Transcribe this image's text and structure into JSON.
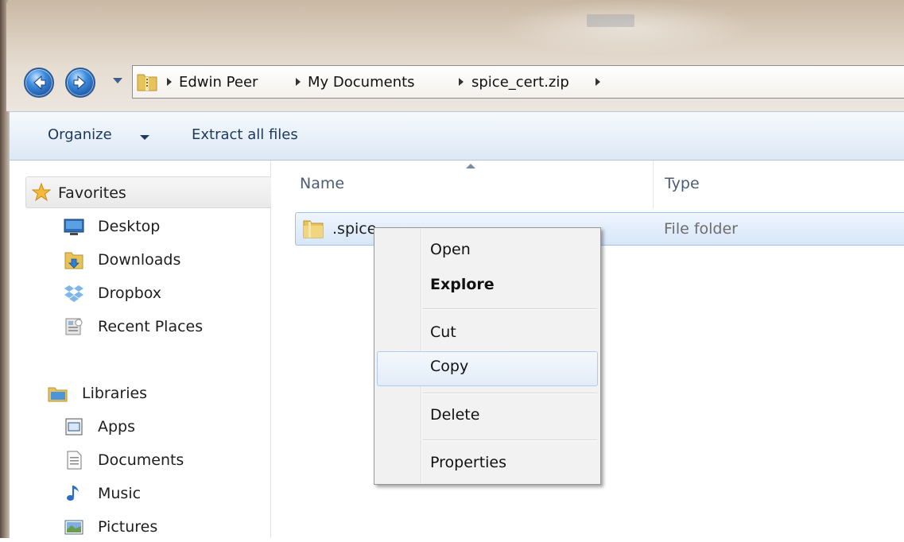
{
  "address_bar": {
    "crumbs": [
      "Edwin Peer",
      "My Documents",
      "spice_cert.zip"
    ]
  },
  "toolbar": {
    "organize_label": "Organize",
    "extract_label": "Extract all files"
  },
  "nav_pane": {
    "favorites_label": "Favorites",
    "favorites": [
      {
        "label": "Desktop",
        "icon": "desktop-icon"
      },
      {
        "label": "Downloads",
        "icon": "downloads-folder-icon"
      },
      {
        "label": "Dropbox",
        "icon": "dropbox-icon"
      },
      {
        "label": "Recent Places",
        "icon": "recent-places-icon"
      }
    ],
    "libraries_label": "Libraries",
    "libraries": [
      {
        "label": "Apps",
        "icon": "apps-library-icon"
      },
      {
        "label": "Documents",
        "icon": "documents-library-icon"
      },
      {
        "label": "Music",
        "icon": "music-note-icon"
      },
      {
        "label": "Pictures",
        "icon": "pictures-library-icon"
      }
    ]
  },
  "content": {
    "columns": {
      "name": "Name",
      "type": "Type"
    },
    "rows": [
      {
        "name": ".spice",
        "type": "File folder"
      }
    ]
  },
  "context_menu": {
    "items": [
      {
        "label": "Open"
      },
      {
        "label": "Explore"
      },
      {
        "label": "Cut"
      },
      {
        "label": "Copy"
      },
      {
        "label": "Delete"
      },
      {
        "label": "Properties"
      }
    ],
    "highlighted": "Copy"
  },
  "colors": {
    "toolbar_text": "#1e395b",
    "selection_border": "#9fc2e8",
    "accent_blue": "#3d8ee0"
  }
}
